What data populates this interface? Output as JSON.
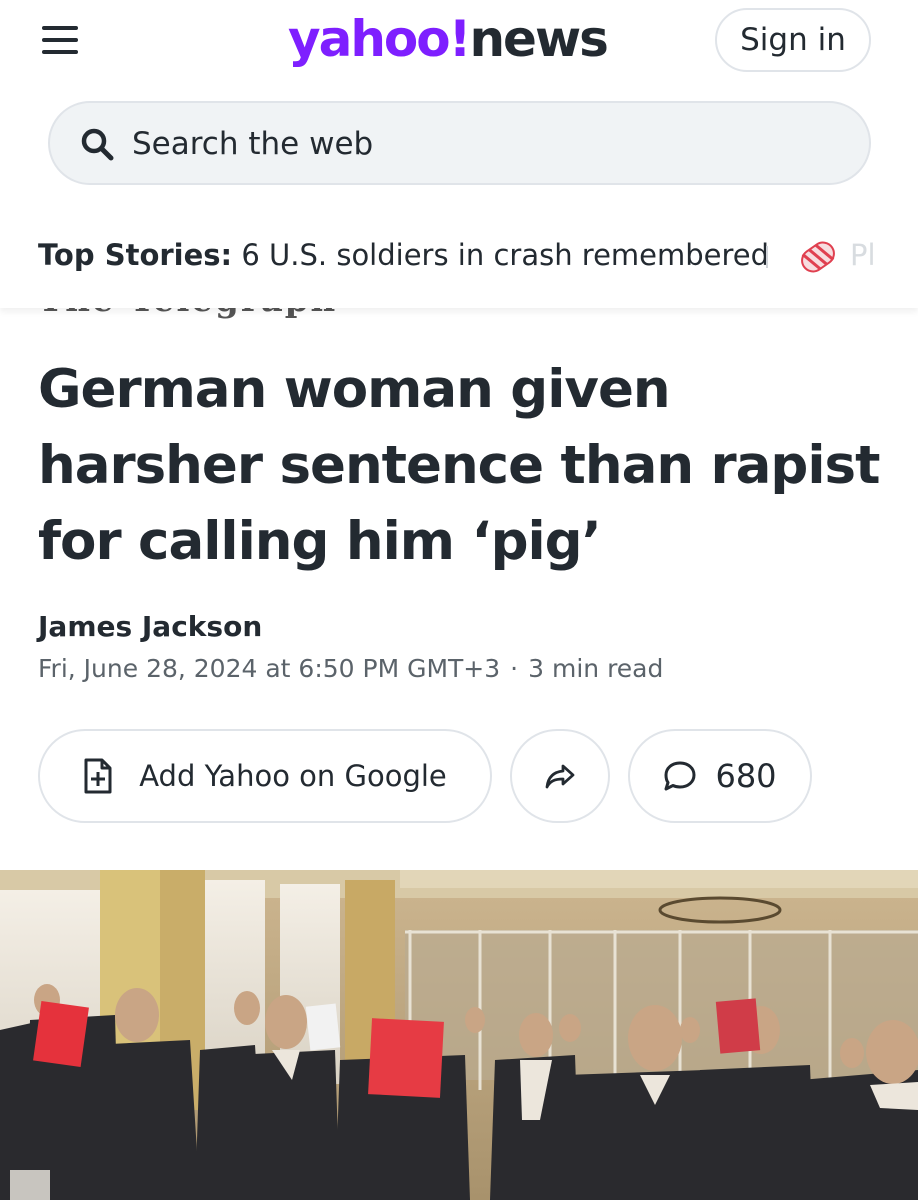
{
  "header": {
    "logo_yahoo": "yahoo!",
    "logo_news": "news",
    "signin_label": "Sign in",
    "menu_icon": "hamburger-menu-icon"
  },
  "search": {
    "placeholder": "Search the web",
    "icon": "search-icon"
  },
  "top_stories": {
    "label": "Top Stories:",
    "headline": "6 U.S. soldiers in crash remembered",
    "next_partial": "Pl"
  },
  "article": {
    "masthead": "The Telegraph",
    "title": "German woman given harsher sentence than rapist for calling him ‘pig’",
    "author": "James Jackson",
    "date": "Fri, June 28, 2024 at 6:50 PM GMT+3",
    "separator": "·",
    "read_time": "3 min read"
  },
  "actions": {
    "add_google_label": "Add Yahoo on Google",
    "share_icon": "share-arrow-icon",
    "comment_icon": "comment-bubble-icon",
    "comment_count": "680"
  },
  "colors": {
    "brand": "#7e1fff",
    "text": "#232a31",
    "muted": "#5b636a",
    "border": "#e0e4e9"
  }
}
